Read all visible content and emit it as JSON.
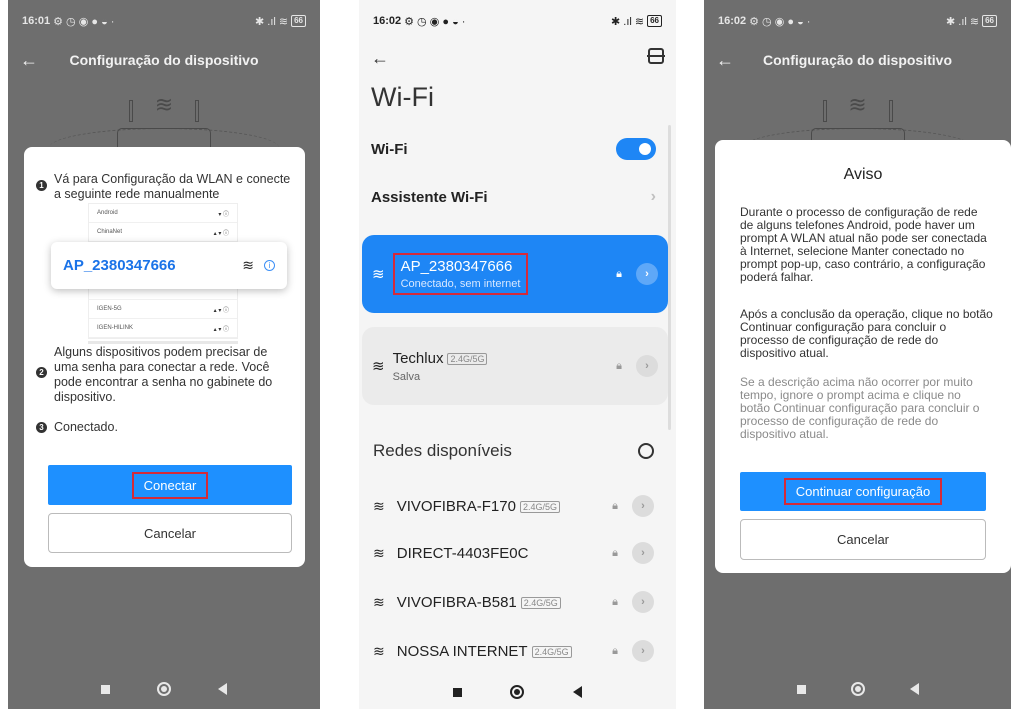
{
  "phone1": {
    "status_time": "16:01",
    "status_icons": "⚙ ◷ ◉ ● ◒ ·",
    "status_right": "✱ .ıl ≋",
    "battery": "66",
    "header_title": "Configuração do dispositivo",
    "step1_text": "Vá para Configuração da WLAN e conecte a seguinte rede manualmente",
    "mini_list": [
      {
        "name": "Android",
        "icons": "▾ ⓘ"
      },
      {
        "name": "ChinaNet",
        "icons": "▴ ▾ ⓘ"
      },
      {
        "name": "IGEN-5G",
        "icons": "▴ ▾ ⓘ"
      },
      {
        "name": "IGEN-HILINK",
        "icons": "▴ ▾ ⓘ"
      }
    ],
    "ap_name": "AP_2380347666",
    "step1_num": "1",
    "step2_num": "2",
    "step3_num": "3",
    "step2_text": "Alguns dispositivos podem precisar de uma senha para conectar a rede. Você pode encontrar a senha no gabinete do dispositivo.",
    "step3_text": "Conectado.",
    "connect_label": "Conectar",
    "cancel_label": "Cancelar"
  },
  "phone2": {
    "status_time": "16:02",
    "status_icons": "⚙ ◷ ◉ ● ◒ ·",
    "status_right": "✱ .ıl ≋",
    "battery": "66",
    "page_title": "Wi-Fi",
    "wifi_label": "Wi-Fi",
    "assistant_label": "Assistente Wi-Fi",
    "saved_networks": [
      {
        "name": "AP_2380347666",
        "status": "Conectado, sem internet"
      },
      {
        "name": "Techlux",
        "tag": "2.4G/5G",
        "status": "Salva"
      }
    ],
    "available_title": "Redes disponíveis",
    "available": [
      {
        "name": "VIVOFIBRA-F170",
        "tag": "2.4G/5G"
      },
      {
        "name": "DIRECT-4403FE0C",
        "tag": ""
      },
      {
        "name": "VIVOFIBRA-B581",
        "tag": "2.4G/5G"
      },
      {
        "name": "NOSSA INTERNET",
        "tag": "2.4G/5G"
      }
    ]
  },
  "phone3": {
    "status_time": "16:02",
    "status_icons": "⚙ ◷ ◉ ● ◒ ·",
    "status_right": "✱ .ıl ≋",
    "battery": "66",
    "header_title": "Configuração do dispositivo",
    "dialog_title": "Aviso",
    "para1": "Durante o processo de configuração de rede de alguns telefones Android, pode haver um prompt A WLAN atual não pode ser conectada à Internet, selecione Manter conectado no prompt pop-up, caso contrário, a configuração poderá falhar.",
    "para2": "Após a conclusão da operação, clique no botão Continuar configuração para concluir o processo de configuração de rede do dispositivo atual.",
    "para3": "Se a descrição acima não ocorrer por muito tempo, ignore o prompt acima e clique no botão Continuar configuração para concluir o processo de configuração de rede do dispositivo atual.",
    "continue_label": "Continuar configuração",
    "cancel_label": "Cancelar"
  },
  "colors": {
    "primary": "#1e90ff",
    "highlight_box": "#d42a3a",
    "overlay": "#6e6e6e"
  }
}
